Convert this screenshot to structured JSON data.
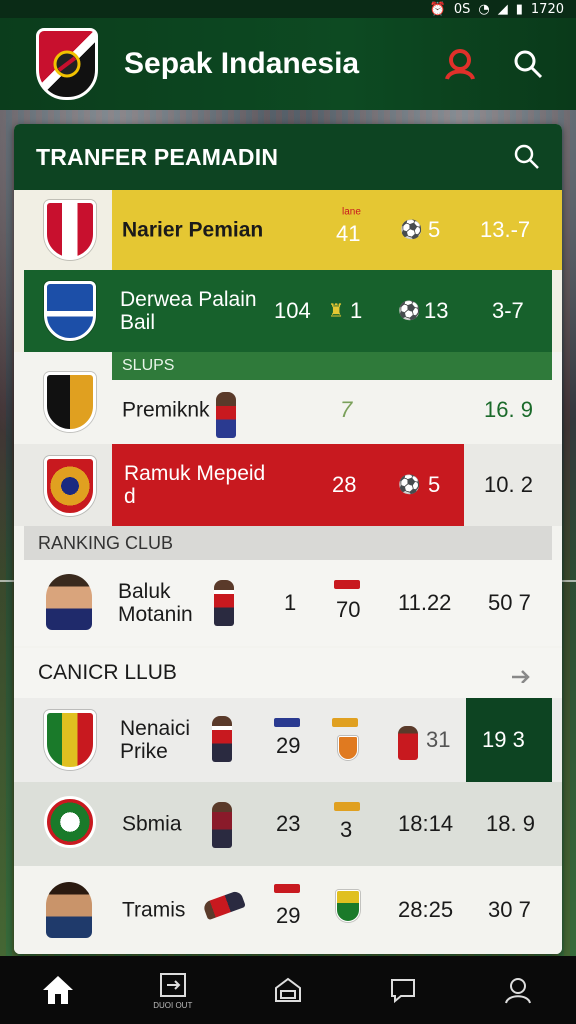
{
  "status_bar": {
    "icons": [
      "alarm-icon",
      "vibrate-icon",
      "signal-icon",
      "wifi-icon",
      "battery-icon"
    ],
    "time": "1720",
    "carrier_text": "0S"
  },
  "app": {
    "title": "Sepak Indanesia"
  },
  "card": {
    "title": "TRANFER PEAMADIN"
  },
  "rows": [
    {
      "name": "Narier Pemian",
      "small_label": "lane",
      "v1": "41",
      "v2": "5",
      "v3": "13.-7"
    },
    {
      "name_line1": "Derwea Palain",
      "name_line2": "Bail",
      "v0": "104",
      "v1": "1",
      "v2": "13",
      "v3": "3-7"
    },
    {
      "sub_label": "SLUPS"
    },
    {
      "name": "Premiknk",
      "v2": "7",
      "v3": "16. 9"
    },
    {
      "name_line1": "Ramuk Mepeid",
      "name_line2": "d",
      "v1": "28",
      "v2": "5",
      "v3": "10. 2"
    }
  ],
  "section_ranking": {
    "label": "RANKING CLUB"
  },
  "ranking_row": {
    "name_line1": "Baluk",
    "name_line2": "Motanin",
    "v0": "1",
    "v1": "70",
    "v2": "11.22",
    "v3": "50 7"
  },
  "section_canicr": {
    "label": "CANICR LLUB"
  },
  "club_rows": [
    {
      "name_line1": "Nenaici",
      "name_line2": "Prike",
      "v1": "29",
      "v2": "31",
      "v3": "19 3"
    },
    {
      "name": "Sbmia",
      "v1": "23",
      "v1b": "3",
      "v2": "18:14",
      "v3": "18. 9"
    },
    {
      "name": "Tramis",
      "v1": "29",
      "v2": "28:25",
      "v3": "30 7"
    }
  ],
  "bottom_nav": [
    {
      "icon": "home-icon",
      "label": ""
    },
    {
      "icon": "transfer-icon",
      "label": "DUOI OUT"
    },
    {
      "icon": "stadium-icon",
      "label": ""
    },
    {
      "icon": "chat-icon",
      "label": ""
    },
    {
      "icon": "profile-icon",
      "label": ""
    }
  ],
  "colors": {
    "primary_green": "#0d4422",
    "yellow_row": "#e5c733",
    "red_row": "#c8191f",
    "dark_green_cell": "#0d4422"
  }
}
